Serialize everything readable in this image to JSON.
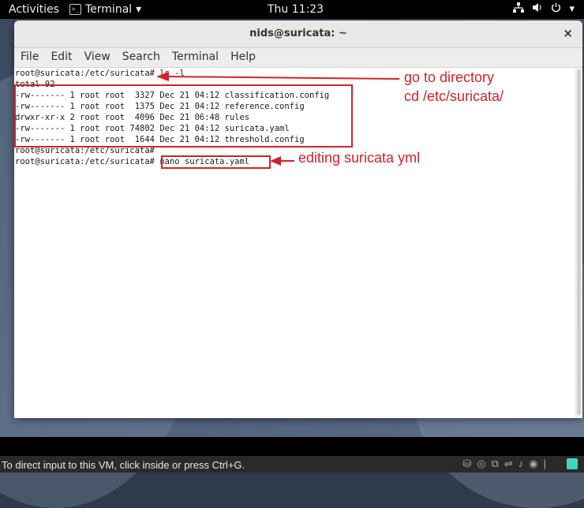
{
  "topbar": {
    "activities": "Activities",
    "app_name": "Terminal",
    "app_menu_arrow": "▾",
    "clock": "Thu 11:23",
    "icons": [
      "network-icon",
      "volume-icon",
      "power-icon",
      "chevron-down-icon"
    ]
  },
  "window": {
    "title": "nids@suricata: ~",
    "close_label": "×",
    "menu": [
      "File",
      "Edit",
      "View",
      "Search",
      "Terminal",
      "Help"
    ]
  },
  "terminal": {
    "lines": [
      "root@suricata:/etc/suricata# ls -l",
      "total 92",
      "-rw------- 1 root root  3327 Dec 21 04:12 classification.config",
      "-rw------- 1 root root  1375 Dec 21 04:12 reference.config",
      "drwxr-xr-x 2 root root  4096 Dec 21 06:48 rules",
      "-rw------- 1 root root 74802 Dec 21 04:12 suricata.yaml",
      "-rw------- 1 root root  1644 Dec 21 04:12 threshold.config",
      "root@suricata:/etc/suricata#",
      "root@suricata:/etc/suricata# nano suricata.yaml"
    ]
  },
  "annotations": {
    "goto_line1": "go to directory",
    "goto_line2": "cd /etc/suricata/",
    "editing": "editing suricata yml",
    "color": "#d2232a"
  },
  "statusbar": {
    "text": "To direct input to this VM, click inside or press Ctrl+G."
  }
}
